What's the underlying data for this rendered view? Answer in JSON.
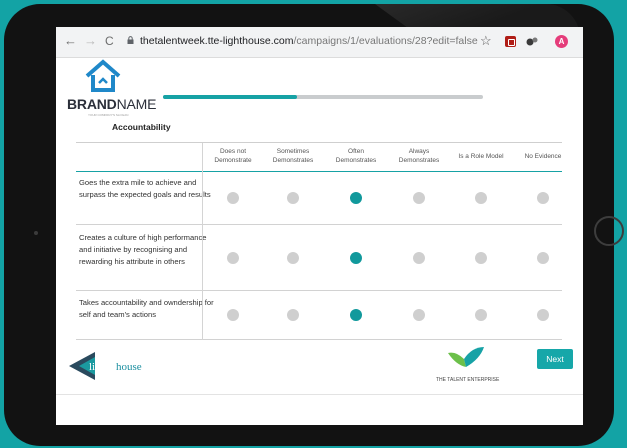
{
  "browser": {
    "url_domain": "thetalentweek.tte-lighthouse.com",
    "url_path": "/campaigns/1/evaluations/28?edit=false",
    "profile_initial": "A",
    "nav": {
      "back": "←",
      "forward": "→",
      "reload": "C"
    },
    "star": "☆"
  },
  "brand": {
    "name_bold": "BRAND",
    "name_regular": "NAME",
    "tagline": "YOUR COMPANY'S SLOGAN"
  },
  "progress": {
    "fraction": 0.42
  },
  "section": {
    "title": "Accountability"
  },
  "columns": [
    {
      "line1": "Does not",
      "line2": "Demonstrate"
    },
    {
      "line1": "Sometimes",
      "line2": "Demonstrates"
    },
    {
      "line1": "Often",
      "line2": "Demonstrates"
    },
    {
      "line1": "Always",
      "line2": "Demonstrates"
    },
    {
      "line1": "Is a Role Model",
      "line2": ""
    },
    {
      "line1": "No Evidence",
      "line2": ""
    }
  ],
  "rows": [
    {
      "text": "Goes the extra mile to achieve and surpass the expected goals and results",
      "selected": 2
    },
    {
      "text": "Creates a culture of high performance and initiative by recognising and rewarding his attribute in others",
      "selected": 2
    },
    {
      "text": "Takes accountability and owndership for self and team's actions",
      "selected": 2
    }
  ],
  "footer": {
    "lighthouse_logo_text": "lighthouse",
    "lighthouse_sub": "by the talent enterprise",
    "tte_label": "THE TALENT ENTERPRISE",
    "next_label": "Next"
  },
  "colors": {
    "accent": "#16a2a5",
    "radio_off": "#cfcfcf",
    "radio_on": "#11999c"
  }
}
